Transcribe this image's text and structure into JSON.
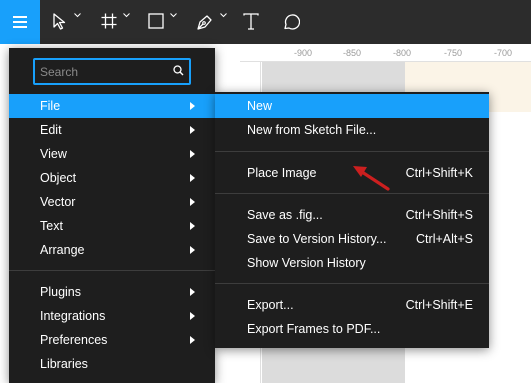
{
  "toolbar": {
    "menu_icon": "hamburger-icon",
    "tools": [
      "move-tool-icon",
      "frame-tool-icon",
      "shape-tool-icon",
      "pen-tool-icon",
      "text-tool-icon",
      "comment-tool-icon"
    ],
    "text_tool_glyph": "T"
  },
  "ruler": {
    "ticks": [
      "-900",
      "-850",
      "-800",
      "-750",
      "-700"
    ]
  },
  "main_menu": {
    "search_placeholder": "Search",
    "items": [
      {
        "label": "File"
      },
      {
        "label": "Edit"
      },
      {
        "label": "View"
      },
      {
        "label": "Object"
      },
      {
        "label": "Vector"
      },
      {
        "label": "Text"
      },
      {
        "label": "Arrange"
      },
      {
        "label": "Plugins"
      },
      {
        "label": "Integrations"
      },
      {
        "label": "Preferences"
      },
      {
        "label": "Libraries"
      }
    ]
  },
  "file_menu": {
    "items": [
      {
        "label": "New",
        "shortcut": ""
      },
      {
        "label": "New from Sketch File...",
        "shortcut": ""
      },
      {
        "label": "Place Image",
        "shortcut": "Ctrl+Shift+K"
      },
      {
        "label": "Save as .fig...",
        "shortcut": "Ctrl+Shift+S"
      },
      {
        "label": "Save to Version History...",
        "shortcut": "Ctrl+Alt+S"
      },
      {
        "label": "Show Version History",
        "shortcut": ""
      },
      {
        "label": "Export...",
        "shortcut": "Ctrl+Shift+E"
      },
      {
        "label": "Export Frames to PDF...",
        "shortcut": ""
      }
    ]
  },
  "colors": {
    "accent": "#18a0fb",
    "menu_bg": "#1e1e1e",
    "toolbar_bg": "#2c2c2c",
    "annotation": "#cc1f1f"
  }
}
